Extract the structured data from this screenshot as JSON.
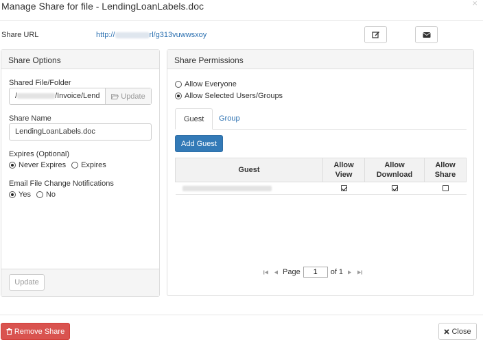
{
  "modal": {
    "title": "Manage Share for file - LendingLoanLabels.doc",
    "close_glyph": "×"
  },
  "share_url": {
    "label": "Share URL",
    "prefix": "http://",
    "suffix": "rl/g313vuwwsxoy"
  },
  "share_options": {
    "heading": "Share Options",
    "shared_file_label": "Shared File/Folder",
    "path_prefix": "/",
    "path_suffix": "/Invoice/Lend",
    "update_inline_label": "Update",
    "share_name_label": "Share Name",
    "share_name_value": "LendingLoanLabels.doc",
    "expires_label": "Expires (Optional)",
    "expires_options": [
      "Never Expires",
      "Expires"
    ],
    "notify_label": "Email File Change Notifications",
    "notify_options": [
      "Yes",
      "No"
    ],
    "update_button": "Update"
  },
  "share_permissions": {
    "heading": "Share Permissions",
    "allow_everyone": "Allow Everyone",
    "allow_selected": "Allow Selected Users/Groups",
    "tabs": [
      "Guest",
      "Group"
    ],
    "add_guest_button": "Add Guest",
    "table": {
      "headers": [
        "Guest",
        "Allow View",
        "Allow Download",
        "Allow Share"
      ],
      "rows": [
        {
          "allow_view": true,
          "allow_download": true,
          "allow_share": false
        }
      ]
    },
    "pager": {
      "page_label": "Page",
      "page_value": "1",
      "of_label": "of 1"
    }
  },
  "footer": {
    "remove_button": "Remove Share",
    "close_button": "Close"
  },
  "colors": {
    "primary": "#337ab7",
    "danger": "#d9534f",
    "link": "#2a6fb0"
  }
}
